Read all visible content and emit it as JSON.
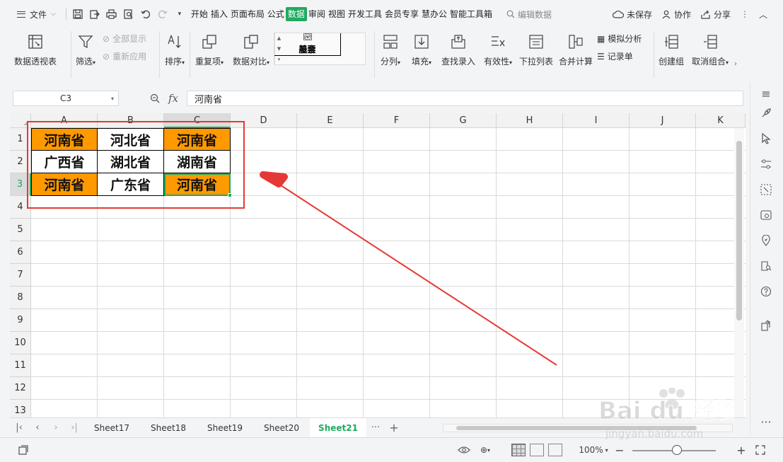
{
  "colors": {
    "accent": "#1eaa5f",
    "highlight": "#ff9900",
    "annotation": "#e53935"
  },
  "menubar": {
    "file_label": "文件",
    "tabs": [
      "开始",
      "插入",
      "页面布局",
      "公式",
      "数据",
      "审阅",
      "视图",
      "开发工具",
      "会员专享",
      "慧办公",
      "智能工具箱"
    ],
    "active_tab": "数据",
    "search_label": "编辑数据",
    "unsaved_label": "未保存",
    "collab_label": "协作",
    "share_label": "分享"
  },
  "ribbon": {
    "pivot": "数据透视表",
    "filter": "筛选",
    "show_all": "全部显示",
    "reapply": "重新应用",
    "sort": "排序",
    "duplicates": "重复项",
    "compare": "数据对比",
    "stocks": "股票",
    "funds": "基金",
    "split": "分列",
    "fill": "填充",
    "lookup_entry": "查找录入",
    "validity": "有效性",
    "dropdown_list": "下拉列表",
    "consolidate": "合并计算",
    "what_if": "模拟分析",
    "record_sheet": "记录单",
    "create_group": "创建组",
    "ungroup": "取消组合"
  },
  "formula_bar": {
    "cell_ref": "C3",
    "fx_label": "fx",
    "content": "河南省"
  },
  "grid": {
    "columns": [
      "A",
      "B",
      "C",
      "D",
      "E",
      "F",
      "G",
      "H",
      "I",
      "J",
      "K"
    ],
    "rows": [
      "1",
      "2",
      "3",
      "4",
      "5",
      "6",
      "7",
      "8",
      "9",
      "10",
      "11",
      "12",
      "13"
    ],
    "selected_column": "C",
    "selected_row": "3",
    "cells": [
      {
        "ref": "A1",
        "text": "河南省",
        "highlight": true
      },
      {
        "ref": "B1",
        "text": "河北省",
        "highlight": false
      },
      {
        "ref": "C1",
        "text": "河南省",
        "highlight": true
      },
      {
        "ref": "A2",
        "text": "广西省",
        "highlight": false
      },
      {
        "ref": "B2",
        "text": "湖北省",
        "highlight": false
      },
      {
        "ref": "C2",
        "text": "湖南省",
        "highlight": false
      },
      {
        "ref": "A3",
        "text": "河南省",
        "highlight": true
      },
      {
        "ref": "B3",
        "text": "广东省",
        "highlight": false
      },
      {
        "ref": "C3",
        "text": "河南省",
        "highlight": true
      }
    ]
  },
  "sheets": {
    "tabs": [
      "Sheet17",
      "Sheet18",
      "Sheet19",
      "Sheet20",
      "Sheet21"
    ],
    "active": "Sheet21"
  },
  "statusbar": {
    "zoom": "100%",
    "zoom_minus": "−",
    "zoom_plus": "+",
    "zoom_level": 0.53
  },
  "watermark": {
    "brand": "Bai du 经验",
    "url": "jingyan.baidu.com"
  }
}
